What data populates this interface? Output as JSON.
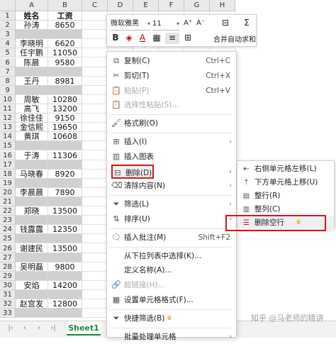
{
  "columns": [
    "A",
    "B",
    "C",
    "D",
    "E",
    "F",
    "G",
    "H"
  ],
  "header_row": {
    "name": "姓名",
    "salary": "工资"
  },
  "rows": [
    {
      "n": "1",
      "name": "姓名",
      "salary": "工资",
      "header": true
    },
    {
      "n": "2",
      "name": "孙涛",
      "salary": "8650"
    },
    {
      "n": "3",
      "name": "",
      "salary": "",
      "selected": true
    },
    {
      "n": "4",
      "name": "李晓明",
      "salary": "6620"
    },
    {
      "n": "5",
      "name": "任宇鹏",
      "salary": "11050"
    },
    {
      "n": "6",
      "name": "陈晨",
      "salary": "9580"
    },
    {
      "n": "7",
      "name": "",
      "salary": "",
      "selected": true
    },
    {
      "n": "8",
      "name": "王丹",
      "salary": "8981"
    },
    {
      "n": "9",
      "name": "",
      "salary": "",
      "selected": true
    },
    {
      "n": "10",
      "name": "周敏",
      "salary": "10280"
    },
    {
      "n": "11",
      "name": "高飞",
      "salary": "13200"
    },
    {
      "n": "12",
      "name": "徐佳佳",
      "salary": "9150"
    },
    {
      "n": "13",
      "name": "金信熙",
      "salary": "19650"
    },
    {
      "n": "14",
      "name": "黄琪",
      "salary": "10608"
    },
    {
      "n": "15",
      "name": "",
      "salary": "",
      "selected": true
    },
    {
      "n": "16",
      "name": "于涛",
      "salary": "11306"
    },
    {
      "n": "17",
      "name": "",
      "salary": "",
      "selected": true
    },
    {
      "n": "18",
      "name": "马晓春",
      "salary": "8920"
    },
    {
      "n": "19",
      "name": "",
      "salary": "",
      "selected": true
    },
    {
      "n": "20",
      "name": "李晨晨",
      "salary": "7890"
    },
    {
      "n": "21",
      "name": "",
      "salary": "",
      "selected": true
    },
    {
      "n": "22",
      "name": "郑晓",
      "salary": "13500"
    },
    {
      "n": "23",
      "name": "",
      "salary": "",
      "selected": true
    },
    {
      "n": "24",
      "name": "钱露露",
      "salary": "12350"
    },
    {
      "n": "25",
      "name": "",
      "salary": "",
      "selected": true
    },
    {
      "n": "26",
      "name": "谢建民",
      "salary": "13500"
    },
    {
      "n": "27",
      "name": "",
      "salary": "",
      "selected": true
    },
    {
      "n": "28",
      "name": "吴明磊",
      "salary": "9800"
    },
    {
      "n": "29",
      "name": "",
      "salary": "",
      "selected": true
    },
    {
      "n": "30",
      "name": "安焰",
      "salary": "14200"
    },
    {
      "n": "31",
      "name": "",
      "salary": "",
      "selected": true
    },
    {
      "n": "32",
      "name": "赵宫发",
      "salary": "12800"
    },
    {
      "n": "33",
      "name": "",
      "salary": "",
      "selected": true
    }
  ],
  "sheet_tab": "Sheet1",
  "mini_toolbar": {
    "font": "微软雅黑",
    "size": "11",
    "increase_font": "A⁺",
    "decrease_font": "A⁻",
    "merge_label": "合并",
    "autosum_label": "自动求和"
  },
  "context_menu": [
    {
      "icon": "copy-icon",
      "glyph": "⧉",
      "label": "复制(C)",
      "shortcut": "Ctrl+C"
    },
    {
      "icon": "cut-icon",
      "glyph": "✂",
      "label": "剪切(T)",
      "shortcut": "Ctrl+X"
    },
    {
      "icon": "paste-icon",
      "glyph": "📋",
      "label": "粘贴(P)",
      "shortcut": "Ctrl+V",
      "disabled": true
    },
    {
      "icon": "paste-special-icon",
      "glyph": "📋",
      "label": "选择性粘贴(S)...",
      "disabled": true
    },
    {
      "sep": true
    },
    {
      "icon": "format-painter-icon",
      "glyph": "🖌",
      "label": "格式刷(O)"
    },
    {
      "sep": true
    },
    {
      "icon": "insert-icon",
      "glyph": "⊞",
      "label": "插入(I)",
      "submenu": true
    },
    {
      "icon": "insert-chart-icon",
      "glyph": "▥",
      "label": "插入图表"
    },
    {
      "icon": "delete-icon",
      "glyph": "⊟",
      "label": "删除(D)",
      "submenu": true,
      "active": true
    },
    {
      "icon": "clear-content-icon",
      "glyph": "⌫",
      "label": "清除内容(N)",
      "submenu": true
    },
    {
      "sep": true
    },
    {
      "icon": "filter-icon",
      "glyph": "⏷",
      "label": "筛选(L)",
      "submenu": true
    },
    {
      "icon": "sort-icon",
      "glyph": "⇅",
      "label": "排序(U)",
      "submenu": true
    },
    {
      "sep": true
    },
    {
      "icon": "insert-comment-icon",
      "glyph": "🗨",
      "label": "插入批注(M)",
      "shortcut": "Shift+F2"
    },
    {
      "sep": true
    },
    {
      "icon": "",
      "glyph": "",
      "label": "从下拉列表中选择(K)..."
    },
    {
      "icon": "",
      "glyph": "",
      "label": "定义名称(A)..."
    },
    {
      "icon": "hyperlink-icon",
      "glyph": "🔗",
      "label": "超链接(H)...",
      "disabled": true
    },
    {
      "icon": "format-cells-icon",
      "glyph": "▦",
      "label": "设置单元格格式(F)..."
    },
    {
      "sep": true
    },
    {
      "icon": "quick-filter-icon",
      "glyph": "⏷",
      "label": "快捷筛选(B)",
      "crown": true
    },
    {
      "sep": true
    },
    {
      "icon": "",
      "glyph": "",
      "label": "批量处理单元格",
      "submenu": true
    }
  ],
  "delete_submenu": [
    {
      "icon": "shift-left-icon",
      "glyph": "⇤",
      "label": "右侧单元格左移(L)"
    },
    {
      "icon": "shift-up-icon",
      "glyph": "⇡",
      "label": "下方单元格上移(U)"
    },
    {
      "icon": "entire-row-icon",
      "glyph": "▤",
      "label": "整行(R)"
    },
    {
      "icon": "entire-column-icon",
      "glyph": "▥",
      "label": "整列(C)"
    },
    {
      "icon": "delete-empty-rows-icon",
      "glyph": "☰",
      "label": "删除空行",
      "crown": true,
      "highlighted": true
    }
  ],
  "watermark": "知乎 @马老师的精讲"
}
